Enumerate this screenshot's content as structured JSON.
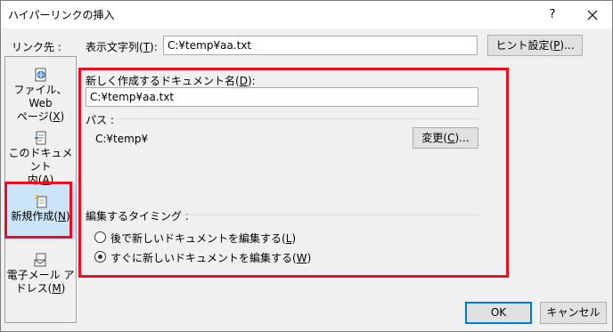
{
  "titlebar": {
    "title": "ハイパーリンクの挿入",
    "help_glyph": "?",
    "close_icon": "close-icon"
  },
  "top": {
    "link_to_label": "リンク先 :",
    "display_text_label": "表示文字列(T):",
    "display_text_value": "C:¥temp¥aa.txt",
    "screentip_button": "ヒント設定(P)..."
  },
  "sidebar": {
    "items": [
      {
        "label_line1": "ファイル、Web",
        "label_line2": "ページ(X)",
        "icon": "web-page-icon",
        "selected": false
      },
      {
        "label_line1": "このドキュメント",
        "label_line2": "内(A)",
        "icon": "document-place-icon",
        "selected": false
      },
      {
        "label_line1": "新規作成(N)",
        "label_line2": "",
        "icon": "new-document-icon",
        "selected": true
      },
      {
        "label_line1": "電子メール ア",
        "label_line2": "ドレス(M)",
        "icon": "email-address-icon",
        "selected": false
      }
    ]
  },
  "main": {
    "new_doc_name_label": "新しく作成するドキュメント名(D):",
    "new_doc_name_value": "C:¥temp¥aa.txt",
    "path_label": "パス :",
    "path_value": "C:¥temp¥",
    "change_button": "変更(C)...",
    "when_to_edit_label": "編集するタイミング :",
    "options": [
      {
        "label": "後で新しいドキュメントを編集する(L)",
        "checked": false
      },
      {
        "label": "すぐに新しいドキュメントを編集する(W)",
        "checked": true
      }
    ]
  },
  "footer": {
    "ok_button": "OK",
    "cancel_button": "キャンセル"
  },
  "colors": {
    "highlight_border": "#e81123",
    "selected_bg": "#cce4f7",
    "default_button_border": "#0078d7"
  }
}
